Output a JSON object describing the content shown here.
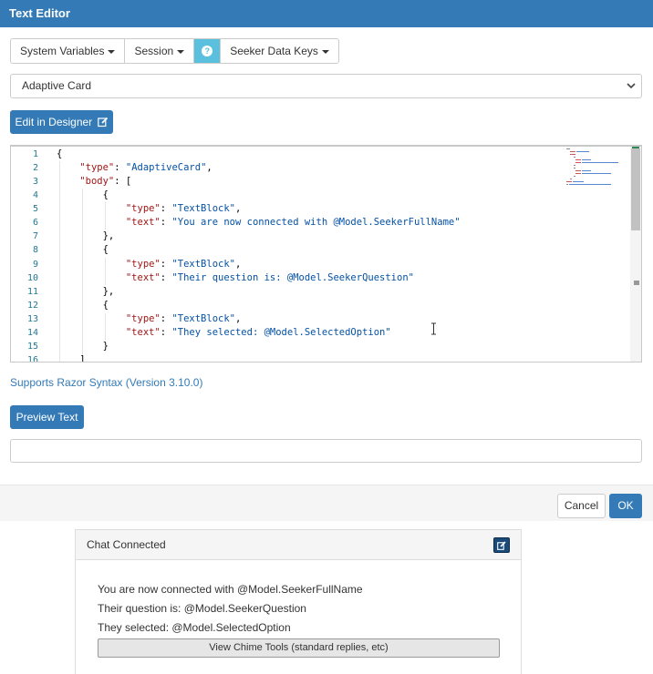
{
  "modal": {
    "title": "Text Editor",
    "toolbar": {
      "system_variables": "System Variables",
      "session": "Session",
      "help_icon": "question-circle",
      "seeker_data_keys": "Seeker Data Keys"
    },
    "format_select": {
      "selected": "Adaptive Card"
    },
    "edit_in_designer": "Edit in Designer",
    "editor": {
      "line_numbers": [
        "1",
        "2",
        "3",
        "4",
        "5",
        "6",
        "7",
        "8",
        "9",
        "10",
        "11",
        "12",
        "13",
        "14",
        "15",
        "16"
      ]
    },
    "razor_link": "Supports Razor Syntax (Version 3.10.0)",
    "preview_button": "Preview Text",
    "preview_output": "",
    "cancel_button": "Cancel",
    "ok_button": "OK"
  },
  "code": {
    "l1": "{",
    "l2_key": "\"type\"",
    "l2_sep": ": ",
    "l2_val": "\"AdaptiveCard\"",
    "l2_end": ",",
    "l3_key": "\"body\"",
    "l3_end": ": [",
    "l4": "{",
    "l5_key": "\"type\"",
    "l5_sep": ": ",
    "l5_val": "\"TextBlock\"",
    "l5_end": ",",
    "l6_key": "\"text\"",
    "l6_sep": ": ",
    "l6_val": "\"You are now connected with @Model.SeekerFullName\"",
    "l7": "},",
    "l8": "{",
    "l9_key": "\"type\"",
    "l9_sep": ": ",
    "l9_val": "\"TextBlock\"",
    "l9_end": ",",
    "l10_key": "\"text\"",
    "l10_sep": ": ",
    "l10_val": "\"Their question is: @Model.SeekerQuestion\"",
    "l11": "},",
    "l12": "{",
    "l13_key": "\"type\"",
    "l13_sep": ": ",
    "l13_val": "\"TextBlock\"",
    "l13_end": ",",
    "l14_key": "\"text\"",
    "l14_sep": ": ",
    "l14_val": "\"They selected: @Model.SelectedOption\"",
    "l15": "}",
    "l16": "]"
  },
  "chat": {
    "title": "Chat Connected",
    "lines": [
      "You are now connected with @Model.SeekerFullName",
      "Their question is: @Model.SeekerQuestion",
      "They selected: @Model.SelectedOption"
    ],
    "chime_tools_button": "View Chime Tools (standard replies, etc)"
  },
  "colors": {
    "primary": "#337ab7",
    "info": "#5bc0de",
    "json_key": "#a31515",
    "json_string": "#0451a5",
    "line_number": "#237893"
  }
}
